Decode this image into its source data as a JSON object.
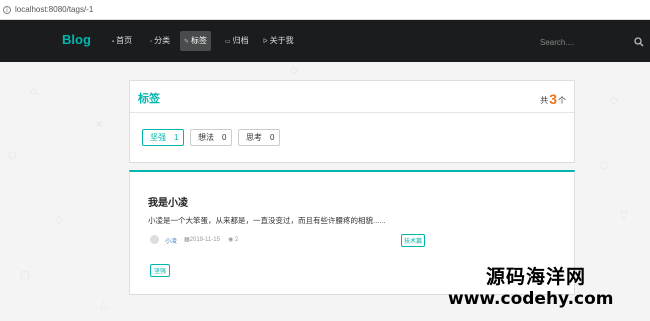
{
  "browser": {
    "url": "localhost:8080/tags/-1"
  },
  "navbar": {
    "brand": "Blog",
    "items": [
      {
        "label": "首页",
        "icon": "home-icon"
      },
      {
        "label": "分类",
        "icon": "idea-icon"
      },
      {
        "label": "标签",
        "icon": "tags-icon"
      },
      {
        "label": "归档",
        "icon": "clone-icon"
      },
      {
        "label": "关于我",
        "icon": "info-icon"
      }
    ],
    "active_index": 2,
    "search_placeholder": "Search...."
  },
  "tags_panel": {
    "title": "标签",
    "count_prefix": "共",
    "count": "3",
    "count_suffix": "个",
    "tags": [
      {
        "name": "坚强",
        "count": "1",
        "active": true
      },
      {
        "name": "想法",
        "count": "0",
        "active": false
      },
      {
        "name": "思考",
        "count": "0",
        "active": false
      }
    ]
  },
  "post": {
    "title": "我是小凌",
    "description": "小凌是一个大笨蛋，从来都是，一直没变过，而且有些许腰疼的相貌......",
    "author": "小凌",
    "date": "2019-11-15",
    "views": "2",
    "type": "技术篇",
    "tag": "坚强"
  },
  "watermark": {
    "line1": "源码海洋网",
    "line2": "www.codehy.com"
  },
  "colors": {
    "accent": "#00b5ad",
    "count": "#f2711c",
    "navbar": "#1b1c1d"
  }
}
